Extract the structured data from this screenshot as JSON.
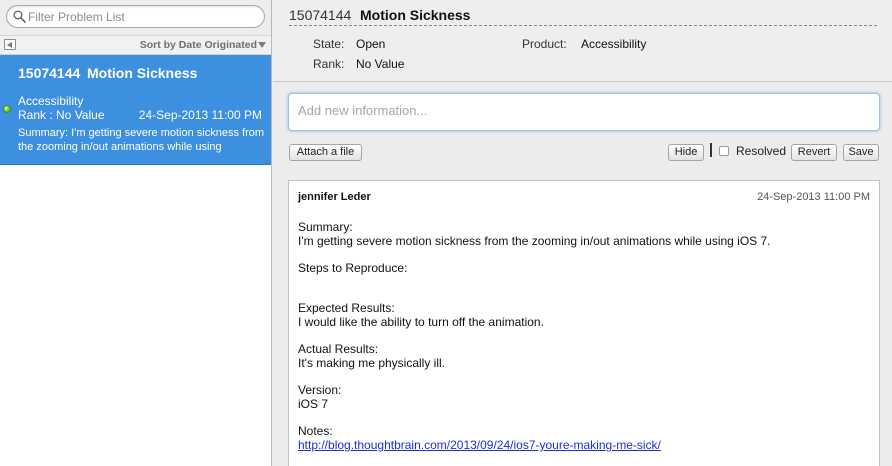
{
  "sidebar": {
    "search_placeholder": "Filter Problem List",
    "sort_label": "Sort by Date Originated",
    "item": {
      "number": "15074144",
      "title": "Motion Sickness",
      "product": "Accessibility",
      "rank": "Rank : No Value",
      "date": "24-Sep-2013 11:00 PM",
      "summary": "Summary: I'm getting severe motion sickness from the zooming in/out animations while using"
    }
  },
  "detail": {
    "number": "15074144",
    "title": "Motion Sickness",
    "state_label": "State:",
    "state_value": "Open",
    "product_label": "Product:",
    "product_value": "Accessibility",
    "rank_label": "Rank:",
    "rank_value": "No Value"
  },
  "composer": {
    "placeholder": "Add new information...",
    "attach_label": "Attach a file",
    "hide_label": "Hide",
    "resolved_label": "Resolved",
    "revert_label": "Revert",
    "save_label": "Save"
  },
  "entry": {
    "author": "jennifer Leder",
    "date": "24-Sep-2013 11:00 PM",
    "summary_heading": "Summary:",
    "summary_text": "I'm getting severe motion sickness from the zooming in/out animations while using iOS 7.",
    "steps_heading": "Steps to Reproduce:",
    "expected_heading": "Expected Results:",
    "expected_text": "I would like the ability to turn off the animation.",
    "actual_heading": "Actual Results:",
    "actual_text": "It's making me physically ill.",
    "version_heading": "Version:",
    "version_text": "iOS 7",
    "notes_heading": "Notes:",
    "notes_link": "http://blog.thoughtbrain.com/2013/09/24/ios7-youre-making-me-sick/"
  },
  "colors": {
    "selection": "#3d8fe0",
    "link": "#1a2fd8",
    "status_dot": "#5fb72a"
  },
  "icons": [
    "search-icon",
    "collapse-icon",
    "sort-arrow-icon",
    "status-dot-icon",
    "checkbox"
  ]
}
